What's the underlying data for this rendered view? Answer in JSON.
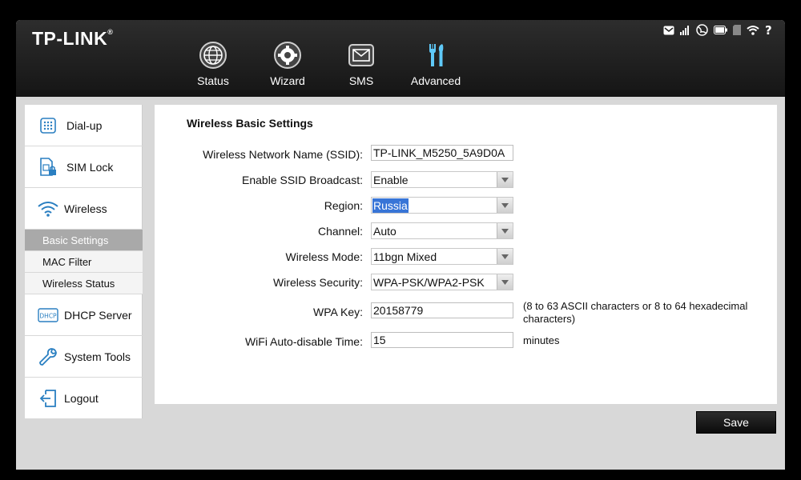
{
  "brand": {
    "name": "TP-LINK",
    "mark": "®"
  },
  "status_icons": [
    "message-icon",
    "signal-icon",
    "internet-icon",
    "battery-icon",
    "sd-card-icon",
    "wifi-icon",
    "help-icon"
  ],
  "nav": [
    {
      "label": "Status",
      "icon": "globe-icon"
    },
    {
      "label": "Wizard",
      "icon": "gear-icon"
    },
    {
      "label": "SMS",
      "icon": "envelope-icon"
    },
    {
      "label": "Advanced",
      "icon": "tools-icon",
      "active": true
    }
  ],
  "sidebar": {
    "dialup": "Dial-up",
    "simlock": "SIM Lock",
    "wireless": "Wireless",
    "sub": [
      "Basic Settings",
      "MAC Filter",
      "Wireless Status"
    ],
    "dhcp": "DHCP Server",
    "dhcp_icon_text": "DHCP",
    "systools": "System Tools",
    "logout": "Logout"
  },
  "form": {
    "title": "Wireless Basic Settings",
    "ssid": {
      "label": "Wireless Network Name (SSID):",
      "value": "TP-LINK_M5250_5A9D0A"
    },
    "broadcast": {
      "label": "Enable SSID Broadcast:",
      "value": "Enable"
    },
    "region": {
      "label": "Region:",
      "value": "Russia"
    },
    "channel": {
      "label": "Channel:",
      "value": "Auto"
    },
    "mode": {
      "label": "Wireless Mode:",
      "value": "11bgn Mixed"
    },
    "security": {
      "label": "Wireless Security:",
      "value": "WPA-PSK/WPA2-PSK"
    },
    "wpakey": {
      "label": "WPA Key:",
      "value": "20158779",
      "note": "(8 to 63 ASCII characters or 8 to 64 hexadecimal characters)"
    },
    "autodisable": {
      "label": "WiFi Auto-disable Time:",
      "value": "15",
      "unit": "minutes"
    }
  },
  "save_label": "Save"
}
